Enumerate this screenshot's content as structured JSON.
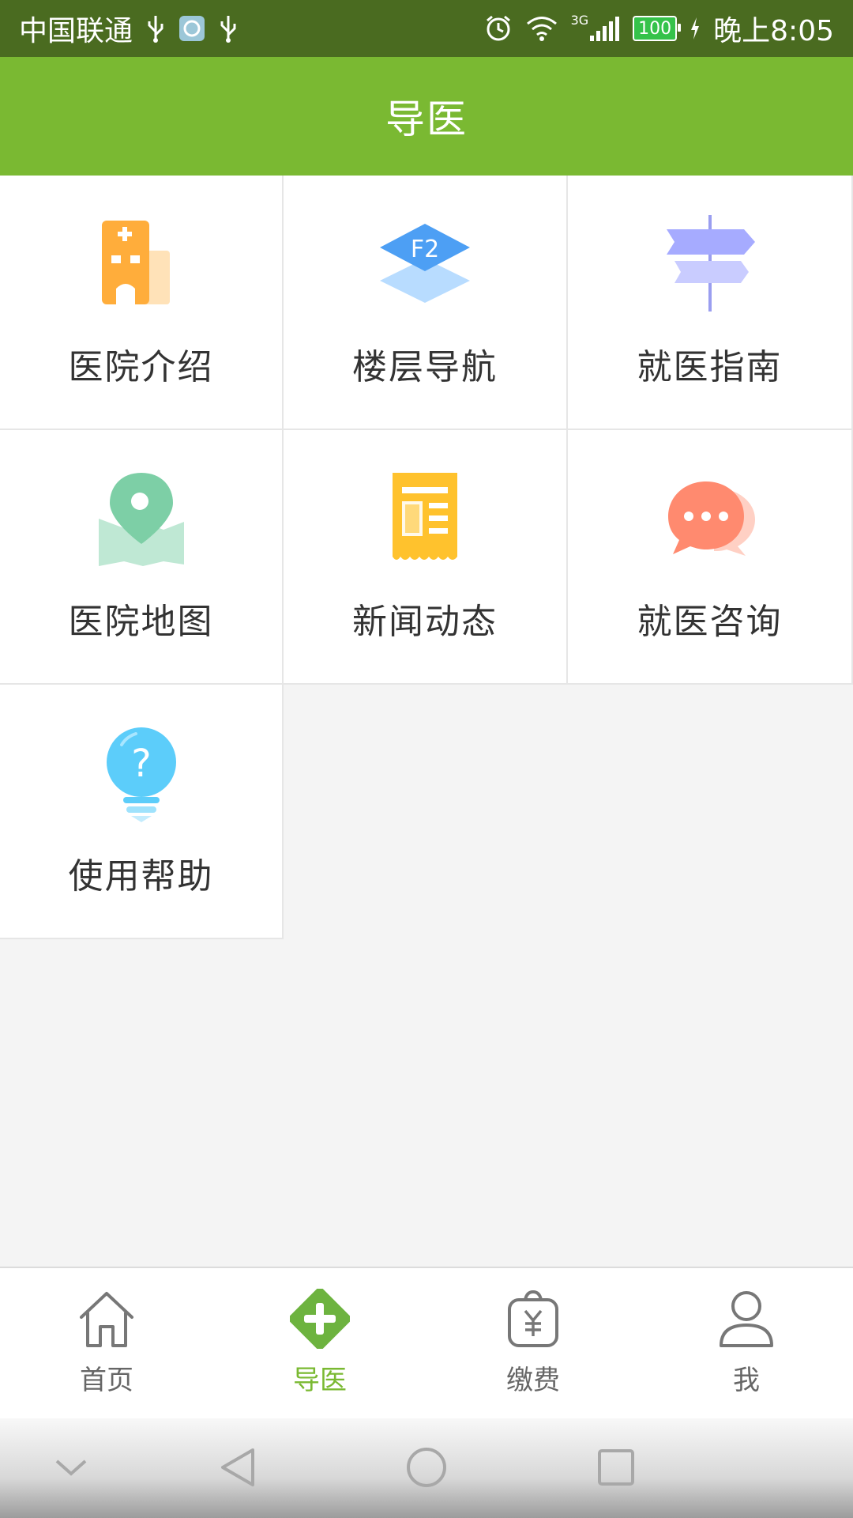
{
  "status_bar": {
    "carrier": "中国联通",
    "network": "3G",
    "battery": "100",
    "time": "晚上8:05"
  },
  "header": {
    "title": "导医"
  },
  "grid": {
    "items": [
      {
        "label": "医院介绍",
        "icon": "hospital-building-icon"
      },
      {
        "label": "楼层导航",
        "icon": "floor-layers-icon"
      },
      {
        "label": "就医指南",
        "icon": "signpost-icon"
      },
      {
        "label": "医院地图",
        "icon": "map-pin-icon"
      },
      {
        "label": "新闻动态",
        "icon": "news-receipt-icon"
      },
      {
        "label": "就医咨询",
        "icon": "chat-bubble-icon"
      },
      {
        "label": "使用帮助",
        "icon": "help-lightbulb-icon"
      }
    ]
  },
  "bottom_nav": {
    "items": [
      {
        "label": "首页",
        "icon": "home-icon",
        "active": false
      },
      {
        "label": "导医",
        "icon": "medical-cross-icon",
        "active": true
      },
      {
        "label": "缴费",
        "icon": "yuan-bag-icon",
        "active": false
      },
      {
        "label": "我",
        "icon": "user-icon",
        "active": false
      }
    ]
  },
  "colors": {
    "status_bar_bg": "#4a6b20",
    "accent": "#7ab932",
    "tile_bg": "#ffffff",
    "page_bg": "#f4f4f4",
    "label_text": "#333333",
    "nav_inactive": "#666666"
  }
}
